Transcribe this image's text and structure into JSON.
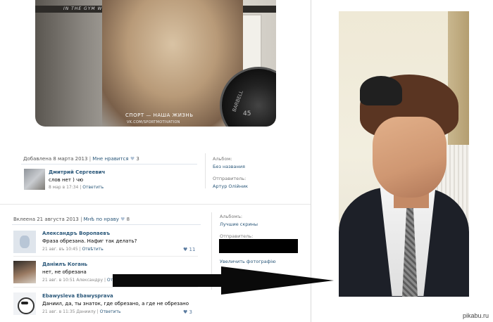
{
  "photo": {
    "banner_text": "IN THE GYM WHERE CHAMPIONS WORKOUT",
    "plate_word": "BARBELL",
    "plate_number": "45",
    "caption_main": "СПОРТ — НАША ЖИЗНЬ",
    "caption_sub": "VK.COM/SPORTMOTIVATION"
  },
  "post1": {
    "added": "Добавлена 8 марта 2013",
    "like_label": "Мне нравится",
    "like_count": "3",
    "comment": {
      "author": "Дмитрий Сергеевич",
      "text": "слов нет ) чю",
      "time": "8 мар в 17:34",
      "reply": "Ответить"
    },
    "side": {
      "album_label": "Альбом:",
      "album_value": "Без названия",
      "sender_label": "Отправитель:",
      "sender_value": "Артур Олійник"
    }
  },
  "post2": {
    "added": "Вклеена 21 августа 2013",
    "like_label": "Мнѣ по нраву",
    "like_count": "8",
    "side": {
      "album_label": "Альбомъ:",
      "album_value": "Лучшие скрины",
      "sender_label": "Отправитель:",
      "enlarge": "Увеличить фотографію"
    },
    "comments": [
      {
        "author": "Александръ Воропаевъ",
        "text": "Фраза обрезана. Нафиг так делать?",
        "time": "21 авг. въ 10:45",
        "reply": "Отвѣтить",
        "likes": "11"
      },
      {
        "author": "Даніилъ Когань",
        "text": "нет, не обрезана",
        "time": "21 авг. в 10:51 Александру",
        "reply": "Ответить",
        "likes": ""
      },
      {
        "author": "Ebawysleva Ebawysprava",
        "text": "Даниил, да, ты знаток, где обрезано, а где не обрезано",
        "time": "21 авг. в 11:35 Даниилу",
        "reply": "Ответить",
        "likes": "3"
      }
    ]
  },
  "watermark": "pikabu.ru",
  "colors": {
    "link": "#2b587a",
    "heart": "#aec0d4",
    "redaction": "#000000"
  }
}
